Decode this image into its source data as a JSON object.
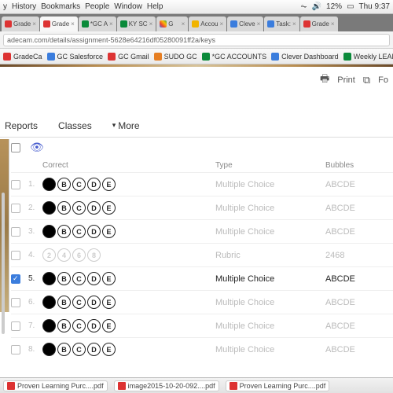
{
  "menubar": {
    "items": [
      "y",
      "History",
      "Bookmarks",
      "People",
      "Window",
      "Help"
    ],
    "battery": "12%",
    "clock": "Thu 9:37"
  },
  "tabs": [
    {
      "label": "Grade",
      "fav": "red"
    },
    {
      "label": "Grade",
      "fav": "red",
      "active": true
    },
    {
      "label": "*GC A",
      "fav": "grn"
    },
    {
      "label": "KY SC",
      "fav": "grn"
    },
    {
      "label": "G",
      "fav": "mlt"
    },
    {
      "label": "Accou",
      "fav": "ylw"
    },
    {
      "label": "Cleve",
      "fav": "blu"
    },
    {
      "label": "Task:",
      "fav": "blu"
    },
    {
      "label": "Grade",
      "fav": "red"
    }
  ],
  "url": "adecam.com/details/assignment-5628e64216df05280091ff2a/keys",
  "bookmarks": [
    {
      "label": "GradeCa",
      "cls": "red"
    },
    {
      "label": "GC Salesforce",
      "cls": "blu"
    },
    {
      "label": "GC Gmail",
      "cls": "red"
    },
    {
      "label": "SUDO GC",
      "cls": "org"
    },
    {
      "label": "*GC ACCOUNTS",
      "cls": "grn"
    },
    {
      "label": "Clever Dashboard",
      "cls": "cle"
    },
    {
      "label": "Weekly LEAD",
      "cls": "grn"
    }
  ],
  "toolbar": {
    "print": "Print",
    "form": "Fo"
  },
  "subtabs": {
    "reports": "Reports",
    "classes": "Classes",
    "more": "More"
  },
  "columns": {
    "correct": "Correct",
    "type": "Type",
    "bubbles": "Bubbles"
  },
  "rows": [
    {
      "n": "1.",
      "letters": [
        "A",
        "B",
        "C",
        "D",
        "E"
      ],
      "filled": [
        0
      ],
      "type": "Multiple Choice",
      "bub": "ABCDE",
      "dim": true
    },
    {
      "n": "2.",
      "letters": [
        "A",
        "B",
        "C",
        "D",
        "E"
      ],
      "filled": [
        0
      ],
      "type": "Multiple Choice",
      "bub": "ABCDE",
      "dim": true
    },
    {
      "n": "3.",
      "letters": [
        "A",
        "B",
        "C",
        "D",
        "E"
      ],
      "filled": [
        0
      ],
      "type": "Multiple Choice",
      "bub": "ABCDE",
      "dim": true
    },
    {
      "n": "4.",
      "letters": [
        "2",
        "4",
        "6",
        "8"
      ],
      "filled": [],
      "type": "Rubric",
      "bub": "2468",
      "dim": true,
      "rubric": true
    },
    {
      "n": "5.",
      "letters": [
        "A",
        "B",
        "C",
        "D",
        "E"
      ],
      "filled": [
        0
      ],
      "type": "Multiple Choice",
      "bub": "ABCDE",
      "sel": true
    },
    {
      "n": "6.",
      "letters": [
        "A",
        "B",
        "C",
        "D",
        "E"
      ],
      "filled": [
        0
      ],
      "type": "Multiple Choice",
      "bub": "ABCDE",
      "dim": true
    },
    {
      "n": "7.",
      "letters": [
        "A",
        "B",
        "C",
        "D",
        "E"
      ],
      "filled": [
        0
      ],
      "type": "Multiple Choice",
      "bub": "ABCDE",
      "dim": true
    },
    {
      "n": "8.",
      "letters": [
        "A",
        "B",
        "C",
        "D",
        "E"
      ],
      "filled": [
        0
      ],
      "type": "Multiple Choice",
      "bub": "ABCDE",
      "dim": true
    }
  ],
  "downloads": [
    {
      "label": "Proven Learning Purc....pdf"
    },
    {
      "label": "image2015-10-20-092....pdf"
    },
    {
      "label": "Proven Learning Purc....pdf"
    }
  ]
}
